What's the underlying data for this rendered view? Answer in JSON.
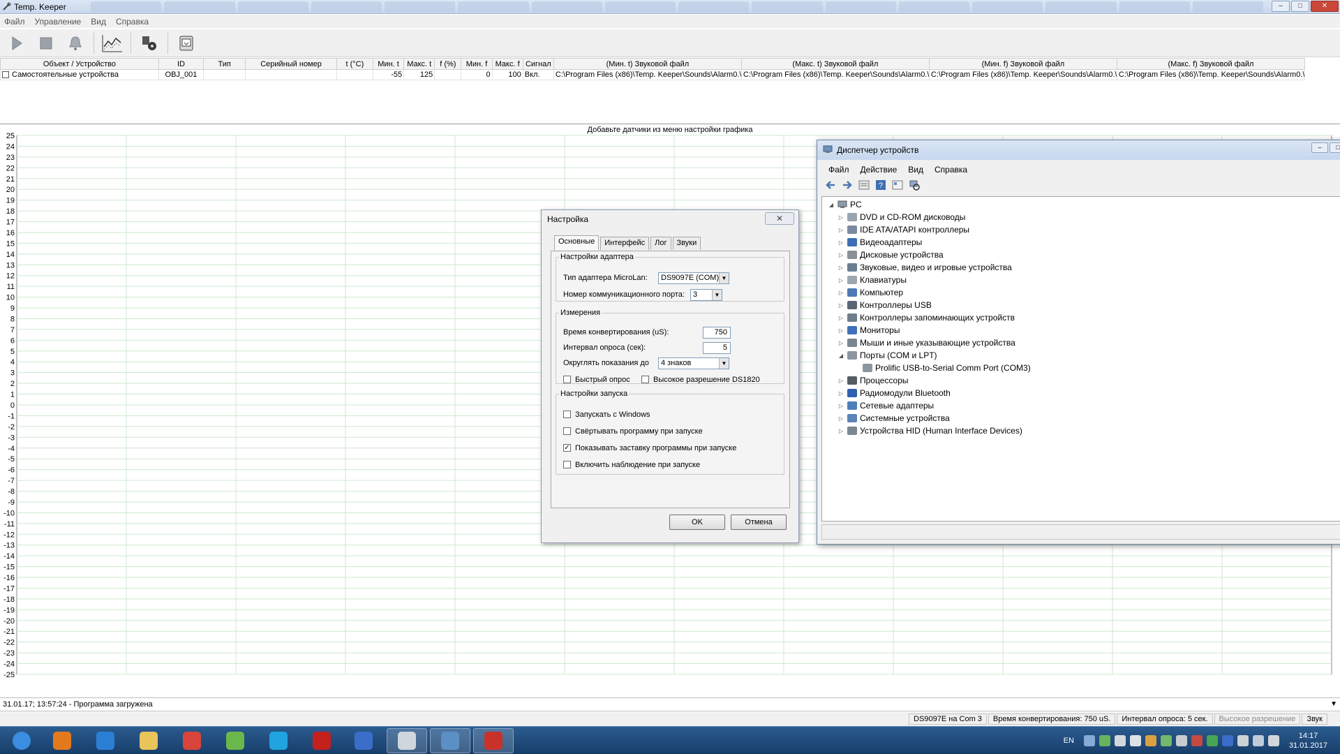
{
  "window": {
    "title": "Temp. Keeper",
    "menu": [
      "Файл",
      "Управление",
      "Вид",
      "Справка"
    ]
  },
  "toolbar": {
    "icons": [
      "play-icon",
      "stop-icon",
      "bell-icon",
      "chart-icon",
      "settings-icon",
      "export-icon"
    ]
  },
  "device_table": {
    "columns": [
      "Объект / Устройство",
      "ID",
      "Тип",
      "Серийный номер",
      "t (°C)",
      "Мин. t",
      "Макс. t",
      "f (%)",
      "Мин. f",
      "Макс. f",
      "Сигнал",
      "(Мин. t) Звуковой файл",
      "(Макс. t) Звуковой файл",
      "(Мин. f) Звуковой файл",
      "(Макс. f) Звуковой файл"
    ],
    "rows": [
      [
        "Самостоятельные устройства",
        "OBJ_001",
        "",
        "",
        "",
        "-55",
        "125",
        "",
        "0",
        "100",
        "Вкл.",
        "C:\\Program Files (x86)\\Temp. Keeper\\Sounds\\Alarm0.\\",
        "C:\\Program Files (x86)\\Temp. Keeper\\Sounds\\Alarm0.\\",
        "C:\\Program Files (x86)\\Temp. Keeper\\Sounds\\Alarm0.\\",
        "C:\\Program Files (x86)\\Temp. Keeper\\Sounds\\Alarm0.\\"
      ]
    ]
  },
  "chart_data": {
    "type": "line",
    "title": "Добавьте датчики из меню настройки графика",
    "ylim": [
      -25,
      25
    ],
    "yticks": [
      "25",
      "24",
      "23",
      "22",
      "21",
      "20",
      "19",
      "18",
      "17",
      "16",
      "15",
      "14",
      "13",
      "12",
      "11",
      "10",
      "9",
      "8",
      "7",
      "6",
      "5",
      "4",
      "3",
      "2",
      "1",
      "0",
      "-1",
      "-2",
      "-3",
      "-4",
      "-5",
      "-6",
      "-7",
      "-8",
      "-9",
      "-10",
      "-11",
      "-12",
      "-13",
      "-14",
      "-15",
      "-16",
      "-17",
      "-18",
      "-19",
      "-20",
      "-21",
      "-22",
      "-23",
      "-24",
      "-25"
    ],
    "series": [],
    "grid": true
  },
  "log": {
    "text": "31.01.17; 13:57:24 - Программа загружена"
  },
  "status": {
    "adapter": "DS9097E на Com 3",
    "conversion": "Время конвертирования: 750 uS.",
    "interval": "Интервал опроса: 5 сек.",
    "resolution": "Высокое разрешение",
    "sound": "Звук"
  },
  "settings": {
    "title": "Настройка",
    "tabs": [
      "Основные",
      "Интерфейс",
      "Лог",
      "Звуки"
    ],
    "adapter_group": "Настройки адаптера",
    "adapter_type_label": "Тип адаптера MicroLan:",
    "adapter_type_value": "DS9097E (COM)",
    "port_label": "Номер коммуникационного порта:",
    "port_value": "3",
    "measure_group": "Измерения",
    "conv_label": "Время конвертирования (uS):",
    "conv_value": "750",
    "poll_label": "Интервал опроса (сек):",
    "poll_value": "5",
    "round_label": "Округлять показания до",
    "round_value": "4 знаков",
    "fast_poll": "Быстрый опрос",
    "hires": "Высокое разрешение DS1820",
    "launch_group": "Настройки запуска",
    "launch_windows": "Запускать с Windows",
    "minimize_start": "Свёртывать программу при запуске",
    "show_splash": "Показывать заставку программы при запуске",
    "monitor_start": "Включить наблюдение при запуске",
    "ok": "OK",
    "cancel": "Отмена"
  },
  "device_manager": {
    "title": "Диспетчер устройств",
    "menu": [
      "Файл",
      "Действие",
      "Вид",
      "Справка"
    ],
    "root": "PC",
    "items": [
      {
        "label": "DVD и CD-ROM дисководы",
        "icon": "cdrom-icon",
        "color": "#9aa4b0"
      },
      {
        "label": "IDE ATA/ATAPI контроллеры",
        "icon": "ide-controller-icon",
        "color": "#7a8aa0"
      },
      {
        "label": "Видеоадаптеры",
        "icon": "display-adapter-icon",
        "color": "#3d6fb3"
      },
      {
        "label": "Дисковые устройства",
        "icon": "disk-drive-icon",
        "color": "#8a8f96"
      },
      {
        "label": "Звуковые, видео и игровые устройства",
        "icon": "sound-icon",
        "color": "#6b7f93"
      },
      {
        "label": "Клавиатуры",
        "icon": "keyboard-icon",
        "color": "#9ea6ae"
      },
      {
        "label": "Компьютер",
        "icon": "computer-icon",
        "color": "#4c79b5"
      },
      {
        "label": "Контроллеры USB",
        "icon": "usb-icon",
        "color": "#5b6672"
      },
      {
        "label": "Контроллеры запоминающих устройств",
        "icon": "storage-controller-icon",
        "color": "#6f7d8c"
      },
      {
        "label": "Мониторы",
        "icon": "monitor-icon",
        "color": "#3f72b8"
      },
      {
        "label": "Мыши и иные указывающие устройства",
        "icon": "mouse-icon",
        "color": "#7b8590"
      },
      {
        "label": "Порты (COM и LPT)",
        "icon": "port-icon",
        "color": "#8b96a1",
        "expanded": true
      },
      {
        "label": "Prolific USB-to-Serial Comm Port (COM3)",
        "icon": "serial-port-icon",
        "color": "#8b96a1",
        "child": true
      },
      {
        "label": "Процессоры",
        "icon": "cpu-icon",
        "color": "#555c63"
      },
      {
        "label": "Радиомодули Bluetooth",
        "icon": "bluetooth-icon",
        "color": "#2f5fb0"
      },
      {
        "label": "Сетевые адаптеры",
        "icon": "network-icon",
        "color": "#4e7fb8"
      },
      {
        "label": "Системные устройства",
        "icon": "system-device-icon",
        "color": "#5c84b8"
      },
      {
        "label": "Устройства HID (Human Interface Devices)",
        "icon": "hid-icon",
        "color": "#7c8792"
      }
    ]
  },
  "taskbar": {
    "lang": "EN",
    "time": "14:17",
    "date": "31.01.2017",
    "apps": [
      {
        "icon": "windows-start-icon",
        "color": "#3a8de0"
      },
      {
        "icon": "media-player-icon",
        "color": "#e27a1c"
      },
      {
        "icon": "internet-explorer-icon",
        "color": "#2a7fd4"
      },
      {
        "icon": "explorer-folder-icon",
        "color": "#e9c45a"
      },
      {
        "icon": "chrome-icon",
        "color": "#d9453a"
      },
      {
        "icon": "utorrent-icon",
        "color": "#6ab84c"
      },
      {
        "icon": "skype-icon",
        "color": "#1fa4e0"
      },
      {
        "icon": "acrobat-icon",
        "color": "#c4201e"
      },
      {
        "icon": "info-icon",
        "color": "#3a6ec8"
      },
      {
        "icon": "temp-keeper-icon",
        "color": "#cfd6de"
      },
      {
        "icon": "device-manager-icon",
        "color": "#5c8fc4"
      },
      {
        "icon": "toolbox-icon",
        "color": "#c9322a"
      }
    ]
  }
}
